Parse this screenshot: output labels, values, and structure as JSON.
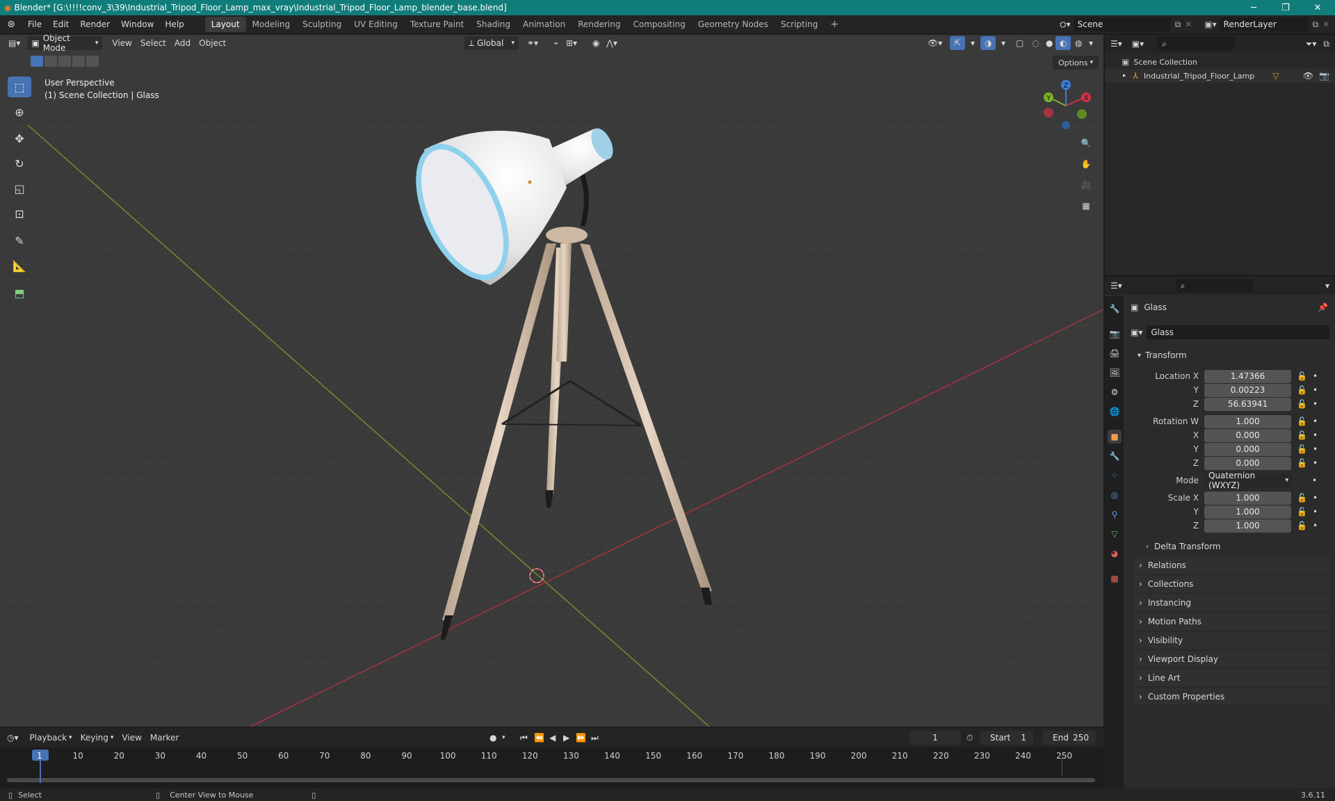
{
  "window": {
    "title": "Blender* [G:\\!!!!conv_3\\39\\Industrial_Tripod_Floor_Lamp_max_vray\\Industrial_Tripod_Floor_Lamp_blender_base.blend]",
    "minimize": "─",
    "maximize": "❐",
    "close": "✕"
  },
  "menus": [
    "File",
    "Edit",
    "Render",
    "Window",
    "Help"
  ],
  "workspaces": [
    "Layout",
    "Modeling",
    "Sculpting",
    "UV Editing",
    "Texture Paint",
    "Shading",
    "Animation",
    "Rendering",
    "Compositing",
    "Geometry Nodes",
    "Scripting"
  ],
  "active_workspace": "Layout",
  "scene": {
    "name": "Scene",
    "render_layer": "RenderLayer"
  },
  "viewport": {
    "mode": "Object Mode",
    "menus": [
      "View",
      "Select",
      "Add",
      "Object"
    ],
    "transform_orientation": "Global",
    "options_label": "Options",
    "overlay_line1": "User Perspective",
    "overlay_line2": "(1) Scene Collection | Glass",
    "gizmo_labels": {
      "x": "X",
      "y": "Y",
      "z": "Z"
    }
  },
  "outliner": {
    "root": "Scene Collection",
    "items": [
      {
        "label": "Industrial_Tripod_Floor_Lamp"
      }
    ]
  },
  "properties": {
    "object_name": "Glass",
    "data_name": "Glass",
    "transform_header": "Transform",
    "location": {
      "label_x": "Location X",
      "label_y": "Y",
      "label_z": "Z",
      "x": "1.47366",
      "y": "0.00223",
      "z": "56.63941"
    },
    "rotation": {
      "label_w": "Rotation W",
      "label_x": "X",
      "label_y": "Y",
      "label_z": "Z",
      "w": "1.000",
      "x": "0.000",
      "y": "0.000",
      "z": "0.000"
    },
    "mode_label": "Mode",
    "mode_value": "Quaternion (WXYZ)",
    "scale": {
      "label_x": "Scale X",
      "label_y": "Y",
      "label_z": "Z",
      "x": "1.000",
      "y": "1.000",
      "z": "1.000"
    },
    "delta": "Delta Transform",
    "panels": [
      "Relations",
      "Collections",
      "Instancing",
      "Motion Paths",
      "Visibility",
      "Viewport Display",
      "Line Art",
      "Custom Properties"
    ]
  },
  "timeline": {
    "menus": [
      "Playback",
      "Keying",
      "View",
      "Marker"
    ],
    "current_frame": "1",
    "start_label": "Start",
    "start": "1",
    "end_label": "End",
    "end": "250",
    "ruler": [
      "1",
      "10",
      "20",
      "30",
      "40",
      "50",
      "60",
      "70",
      "80",
      "90",
      "100",
      "110",
      "120",
      "130",
      "140",
      "150",
      "160",
      "170",
      "180",
      "190",
      "200",
      "210",
      "220",
      "230",
      "240",
      "250"
    ]
  },
  "status": {
    "select": "Select",
    "center": "Center View to Mouse",
    "version": "3.6.11"
  },
  "colors": {
    "accent": "#4772b3",
    "titlebar": "#117d7b",
    "x_axis": "#cc3344",
    "y_axis": "#7ab329",
    "z_axis": "#3d7ddb"
  }
}
